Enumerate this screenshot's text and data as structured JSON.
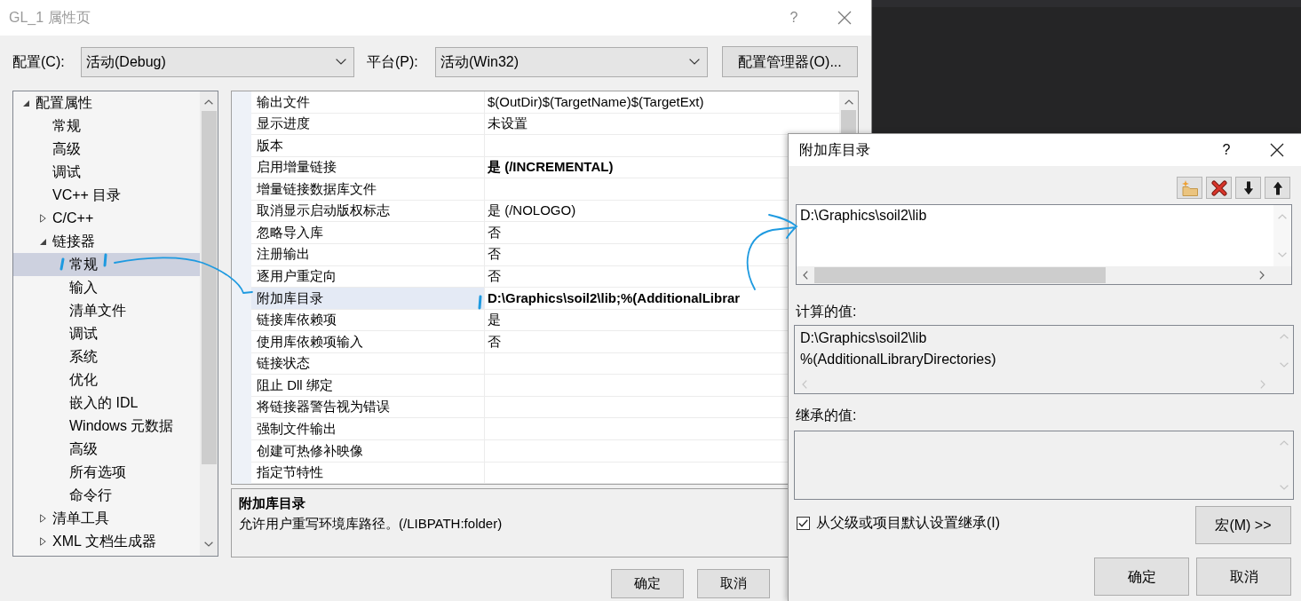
{
  "window": {
    "title": "GL_1 属性页",
    "help": "?"
  },
  "config_bar": {
    "configuration_label": "配置(C):",
    "configuration_value": "活动(Debug)",
    "platform_label": "平台(P):",
    "platform_value": "活动(Win32)",
    "manager_button": "配置管理器(O)..."
  },
  "tree": {
    "items": [
      {
        "label": "配置属性",
        "expanded": true,
        "selected": false,
        "children": [
          {
            "label": "常规",
            "selected": false
          },
          {
            "label": "高级",
            "selected": false
          },
          {
            "label": "调试",
            "selected": false
          },
          {
            "label": "VC++ 目录",
            "selected": false
          },
          {
            "label": "C/C++",
            "expanded": false,
            "selected": false
          },
          {
            "label": "链接器",
            "expanded": true,
            "selected": false,
            "children": [
              {
                "label": "常规",
                "selected": true
              },
              {
                "label": "输入",
                "selected": false
              },
              {
                "label": "清单文件",
                "selected": false
              },
              {
                "label": "调试",
                "selected": false
              },
              {
                "label": "系统",
                "selected": false
              },
              {
                "label": "优化",
                "selected": false
              },
              {
                "label": "嵌入的 IDL",
                "selected": false
              },
              {
                "label": "Windows 元数据",
                "selected": false
              },
              {
                "label": "高级",
                "selected": false
              },
              {
                "label": "所有选项",
                "selected": false
              },
              {
                "label": "命令行",
                "selected": false
              }
            ]
          },
          {
            "label": "清单工具",
            "expanded": false,
            "selected": false
          },
          {
            "label": "XML 文档生成器",
            "expanded": false,
            "selected": false
          }
        ]
      }
    ]
  },
  "grid": {
    "rows": [
      {
        "name": "输出文件",
        "value": "$(OutDir)$(TargetName)$(TargetExt)",
        "modified": false,
        "selected": false
      },
      {
        "name": "显示进度",
        "value": "未设置",
        "modified": false,
        "selected": false
      },
      {
        "name": "版本",
        "selected": false
      },
      {
        "name": "启用增量链接",
        "value": "是 (/INCREMENTAL)",
        "modified": true,
        "selected": false
      },
      {
        "name": "增量链接数据库文件",
        "selected": false
      },
      {
        "name": "取消显示启动版权标志",
        "value": "是 (/NOLOGO)",
        "modified": false,
        "selected": false
      },
      {
        "name": "忽略导入库",
        "value": "否",
        "modified": false,
        "selected": false
      },
      {
        "name": "注册输出",
        "value": "否",
        "modified": false,
        "selected": false
      },
      {
        "name": "逐用户重定向",
        "value": "否",
        "modified": false,
        "selected": false
      },
      {
        "name": "附加库目录",
        "value": "D:\\Graphics\\soil2\\lib;%(AdditionalLibrar",
        "modified": true,
        "selected": true
      },
      {
        "name": "链接库依赖项",
        "value": "是",
        "modified": false,
        "selected": false
      },
      {
        "name": "使用库依赖项输入",
        "value": "否",
        "modified": false,
        "selected": false
      },
      {
        "name": "链接状态",
        "selected": false
      },
      {
        "name": "阻止 Dll 绑定",
        "selected": false
      },
      {
        "name": "将链接器警告视为错误",
        "selected": false
      },
      {
        "name": "强制文件输出",
        "selected": false
      },
      {
        "name": "创建可热修补映像",
        "selected": false
      },
      {
        "name": "指定节特性",
        "selected": false
      }
    ]
  },
  "description": {
    "title": "附加库目录",
    "text": "允许用户重写环境库路径。(/LIBPATH:folder)"
  },
  "buttons": [
    "确定",
    "取消"
  ],
  "dialog": {
    "title": "附加库目录",
    "help": "?",
    "entries": [
      {
        "text": "D:\\Graphics\\soil2\\lib",
        "selected": false
      }
    ],
    "computed_label": "计算的值:",
    "computed_values": [
      "D:\\Graphics\\soil2\\lib",
      "%(AdditionalLibraryDirectories)"
    ],
    "inherited_label": "继承的值:",
    "inherit": {
      "label": "从父级或项目默认设置继承(I)",
      "checked": true
    },
    "macro_button": "宏(M) >>",
    "buttons": [
      "确定",
      "取消"
    ]
  }
}
